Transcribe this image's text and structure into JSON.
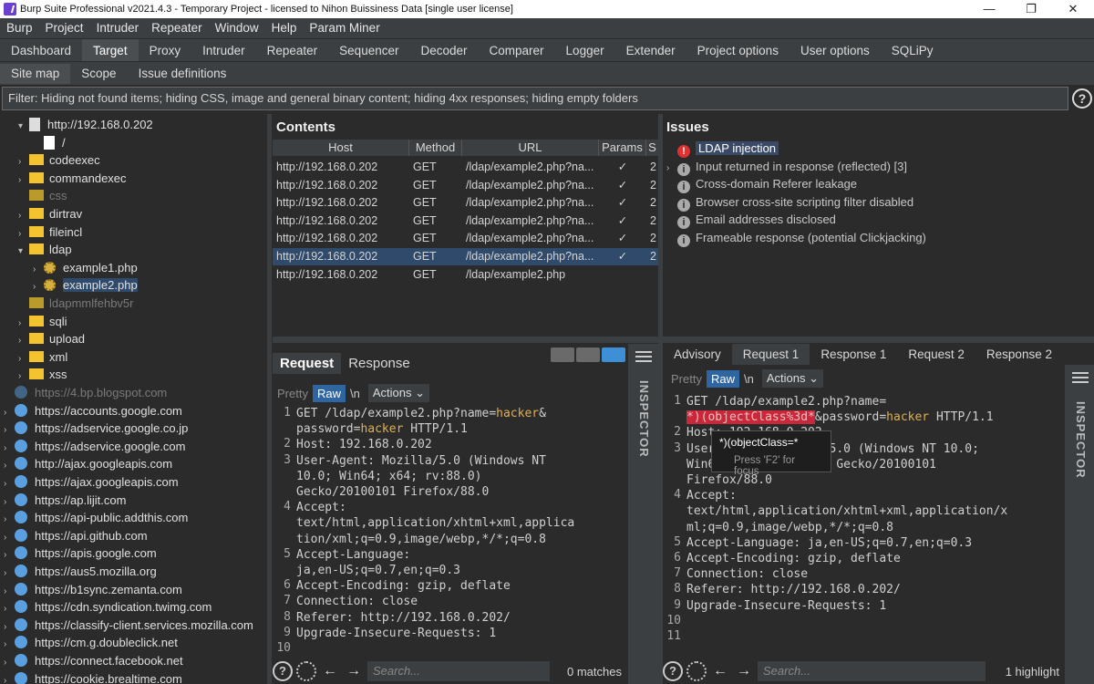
{
  "window": {
    "title": "Burp Suite Professional v2021.4.3 - Temporary Project - licensed to Nihon Buissiness Data [single user license]",
    "minimize": "—",
    "restore": "❐",
    "close": "✕"
  },
  "menu": [
    "Burp",
    "Project",
    "Intruder",
    "Repeater",
    "Window",
    "Help",
    "Param Miner"
  ],
  "main_tabs": [
    "Dashboard",
    "Target",
    "Proxy",
    "Intruder",
    "Repeater",
    "Sequencer",
    "Decoder",
    "Comparer",
    "Logger",
    "Extender",
    "Project options",
    "User options",
    "SQLiPy"
  ],
  "main_tab_active": "Target",
  "sub_tabs": [
    "Site map",
    "Scope",
    "Issue definitions"
  ],
  "filter_text": "Filter: Hiding not found items;  hiding CSS, image and general binary content;  hiding 4xx responses;  hiding empty folders",
  "help_label": "?",
  "tree": [
    {
      "label": "http://192.168.0.202",
      "arrow": "▾",
      "dim": false
    },
    {
      "label": "/",
      "arrow": "",
      "dim": false
    },
    {
      "label": "codeexec",
      "arrow": "›",
      "dim": false
    },
    {
      "label": "commandexec",
      "arrow": "›",
      "dim": false
    },
    {
      "label": "css",
      "arrow": "",
      "dim": true
    },
    {
      "label": "dirtrav",
      "arrow": "›",
      "dim": false
    },
    {
      "label": "fileincl",
      "arrow": "›",
      "dim": false
    },
    {
      "label": "ldap",
      "arrow": "▾",
      "dim": false
    },
    {
      "label": "example1.php",
      "arrow": "›",
      "dim": false
    },
    {
      "label": "example2.php",
      "arrow": "›",
      "dim": false
    },
    {
      "label": "ldapmmlfehbv5r",
      "arrow": "",
      "dim": true
    },
    {
      "label": "sqli",
      "arrow": "›",
      "dim": false
    },
    {
      "label": "upload",
      "arrow": "›",
      "dim": false
    },
    {
      "label": "xml",
      "arrow": "›",
      "dim": false
    },
    {
      "label": "xss",
      "arrow": "›",
      "dim": false
    },
    {
      "label": "https://4.bp.blogspot.com",
      "arrow": "",
      "dim": true
    },
    {
      "label": "https://accounts.google.com",
      "arrow": "›",
      "dim": false
    },
    {
      "label": "https://adservice.google.co.jp",
      "arrow": "›",
      "dim": false
    },
    {
      "label": "https://adservice.google.com",
      "arrow": "›",
      "dim": false
    },
    {
      "label": "http://ajax.googleapis.com",
      "arrow": "›",
      "dim": false
    },
    {
      "label": "https://ajax.googleapis.com",
      "arrow": "›",
      "dim": false
    },
    {
      "label": "https://ap.lijit.com",
      "arrow": "›",
      "dim": false
    },
    {
      "label": "https://api-public.addthis.com",
      "arrow": "›",
      "dim": false
    },
    {
      "label": "https://api.github.com",
      "arrow": "›",
      "dim": false
    },
    {
      "label": "https://apis.google.com",
      "arrow": "›",
      "dim": false
    },
    {
      "label": "https://aus5.mozilla.org",
      "arrow": "›",
      "dim": false
    },
    {
      "label": "https://b1sync.zemanta.com",
      "arrow": "›",
      "dim": false
    },
    {
      "label": "https://cdn.syndication.twimg.com",
      "arrow": "›",
      "dim": false
    },
    {
      "label": "https://classify-client.services.mozilla.com",
      "arrow": "›",
      "dim": false
    },
    {
      "label": "https://cm.g.doubleclick.net",
      "arrow": "›",
      "dim": false
    },
    {
      "label": "https://connect.facebook.net",
      "arrow": "›",
      "dim": false
    },
    {
      "label": "https://cookie.brealtime.com",
      "arrow": "›",
      "dim": false
    }
  ],
  "contents": {
    "title": "Contents",
    "columns": [
      "Host",
      "Method",
      "URL",
      "Params",
      "S"
    ],
    "rows": [
      {
        "host": "http://192.168.0.202",
        "method": "GET",
        "url": "/ldap/example2.php?na...",
        "params": "✓",
        "s": "2"
      },
      {
        "host": "http://192.168.0.202",
        "method": "GET",
        "url": "/ldap/example2.php?na...",
        "params": "✓",
        "s": "2"
      },
      {
        "host": "http://192.168.0.202",
        "method": "GET",
        "url": "/ldap/example2.php?na...",
        "params": "✓",
        "s": "2"
      },
      {
        "host": "http://192.168.0.202",
        "method": "GET",
        "url": "/ldap/example2.php?na...",
        "params": "✓",
        "s": "2"
      },
      {
        "host": "http://192.168.0.202",
        "method": "GET",
        "url": "/ldap/example2.php?na...",
        "params": "✓",
        "s": "2"
      },
      {
        "host": "http://192.168.0.202",
        "method": "GET",
        "url": "/ldap/example2.php?na...",
        "params": "✓",
        "s": "2"
      },
      {
        "host": "http://192.168.0.202",
        "method": "GET",
        "url": "/ldap/example2.php",
        "params": "",
        "s": ""
      }
    ]
  },
  "issues": {
    "title": "Issues",
    "items": [
      {
        "label": "LDAP injection",
        "severity": "high",
        "arrow": ""
      },
      {
        "label": "Input returned in response (reflected) [3]",
        "severity": "info",
        "arrow": "›"
      },
      {
        "label": "Cross-domain Referer leakage",
        "severity": "info",
        "arrow": ""
      },
      {
        "label": "Browser cross-site scripting filter disabled",
        "severity": "info",
        "arrow": ""
      },
      {
        "label": "Email addresses disclosed",
        "severity": "info",
        "arrow": ""
      },
      {
        "label": "Frameable response (potential Clickjacking)",
        "severity": "info",
        "arrow": ""
      }
    ]
  },
  "request_panel": {
    "tabs": [
      "Request",
      "Response"
    ],
    "tools": {
      "pretty": "Pretty",
      "raw": "Raw",
      "newline": "\\n",
      "actions": "Actions ⌄"
    },
    "search_placeholder": "Search...",
    "matches": "0 matches",
    "inspector": "INSPECTOR",
    "line_numbers": [
      "1",
      "",
      "2",
      "3",
      "",
      "",
      "4",
      "",
      "",
      "5",
      "",
      "6",
      "7",
      "8",
      "9",
      "10"
    ],
    "lines": [
      {
        "pre": "GET /ldap/example2.php?name=",
        "hl1": "hacker",
        "mid": "&",
        "hl2": "",
        "post": ""
      },
      {
        "pre": "password=",
        "hl1": "hacker",
        "mid": " HTTP/1.1",
        "hl2": "",
        "post": ""
      },
      {
        "pre": "Host: 192.168.0.202",
        "hl1": "",
        "mid": "",
        "hl2": "",
        "post": ""
      },
      {
        "pre": "User-Agent: Mozilla/5.0 (Windows NT",
        "hl1": "",
        "mid": "",
        "hl2": "",
        "post": ""
      },
      {
        "pre": "10.0; Win64; x64; rv:88.0)",
        "hl1": "",
        "mid": "",
        "hl2": "",
        "post": ""
      },
      {
        "pre": "Gecko/20100101 Firefox/88.0",
        "hl1": "",
        "mid": "",
        "hl2": "",
        "post": ""
      },
      {
        "pre": "Accept:",
        "hl1": "",
        "mid": "",
        "hl2": "",
        "post": ""
      },
      {
        "pre": "text/html,application/xhtml+xml,applica",
        "hl1": "",
        "mid": "",
        "hl2": "",
        "post": ""
      },
      {
        "pre": "tion/xml;q=0.9,image/webp,*/*;q=0.8",
        "hl1": "",
        "mid": "",
        "hl2": "",
        "post": ""
      },
      {
        "pre": "Accept-Language:",
        "hl1": "",
        "mid": "",
        "hl2": "",
        "post": ""
      },
      {
        "pre": "ja,en-US;q=0.7,en;q=0.3",
        "hl1": "",
        "mid": "",
        "hl2": "",
        "post": ""
      },
      {
        "pre": "Accept-Encoding: gzip, deflate",
        "hl1": "",
        "mid": "",
        "hl2": "",
        "post": ""
      },
      {
        "pre": "Connection: close",
        "hl1": "",
        "mid": "",
        "hl2": "",
        "post": ""
      },
      {
        "pre": "Referer: http://192.168.0.202/",
        "hl1": "",
        "mid": "",
        "hl2": "",
        "post": ""
      },
      {
        "pre": "Upgrade-Insecure-Requests: 1",
        "hl1": "",
        "mid": "",
        "hl2": "",
        "post": ""
      },
      {
        "pre": "",
        "hl1": "",
        "mid": "",
        "hl2": "",
        "post": ""
      }
    ]
  },
  "advisory_panel": {
    "tabs": [
      "Advisory",
      "Request 1",
      "Response 1",
      "Request 2",
      "Response 2"
    ],
    "active_tab": "Request 1",
    "tools": {
      "pretty": "Pretty",
      "raw": "Raw",
      "newline": "\\n",
      "actions": "Actions ⌄"
    },
    "search_placeholder": "Search...",
    "matches": "1 highlight",
    "inspector": "INSPECTOR",
    "line_numbers": [
      "1",
      "",
      "2",
      "3",
      "",
      "",
      "4",
      "",
      "",
      "5",
      "6",
      "7",
      "8",
      "9",
      "10",
      "11"
    ],
    "line1": "GET /ldap/example2.php?name=",
    "line1b_hl": "*)(objectClass%3d*",
    "line1b_mid": "&password=",
    "line1b_val": "hacker",
    "line1b_post": " HTTP/1.1",
    "lines": [
      "Host: 192.168.0.202",
      "User-Agent: Mozilla/5.0 (Windows NT 10.0;",
      "Win64; x64; rv:88.0) Gecko/20100101",
      "Firefox/88.0",
      "Accept:",
      "text/html,application/xhtml+xml,application/x",
      "ml;q=0.9,image/webp,*/*;q=0.8",
      "Accept-Language: ja,en-US;q=0.7,en;q=0.3",
      "Accept-Encoding: gzip, deflate",
      "Connection: close",
      "Referer: http://192.168.0.202/",
      "Upgrade-Insecure-Requests: 1"
    ],
    "tooltip_value": "*)(objectClass=*",
    "tooltip_hint": "Press 'F2' for focus"
  }
}
